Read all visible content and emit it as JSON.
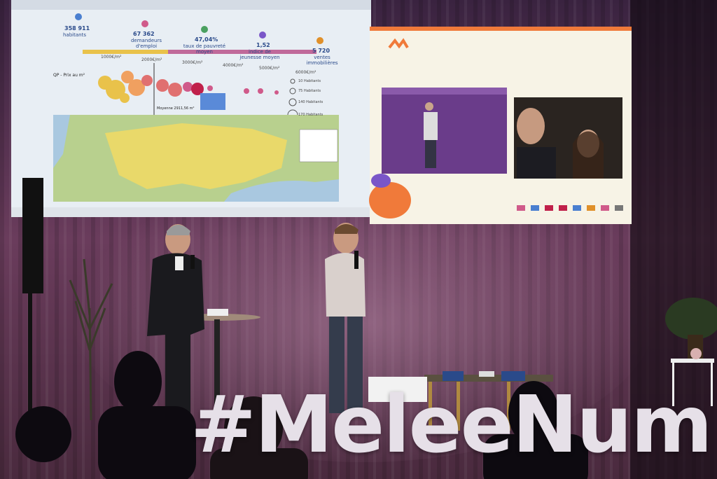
{
  "left_screen": {
    "stats": [
      {
        "value": "358 911",
        "label": "habitants"
      },
      {
        "value": "67 362",
        "label": "demandeurs d'emploi"
      },
      {
        "value": "47,04%",
        "label": "taux de pauvreté moyen"
      },
      {
        "value": "1,52",
        "label": "indice de jeunesse moyen"
      },
      {
        "value": "5 720",
        "label": "ventes immobilières"
      }
    ],
    "scale_labels": [
      "1000€/m²",
      "2000€/m²",
      "3000€/m²",
      "4000€/m²",
      "5000€/m²",
      "6000€/m²"
    ],
    "row_label": "QP - Prix au m²",
    "median_label": "Moyenne 2911,56 m²",
    "legend": [
      "10 Habitants",
      "75 Habitants",
      "140 Habitants",
      "170 Habitants"
    ]
  },
  "right_screen": {
    "logo_text": "MN",
    "bubble_colors": [
      "#f07a3a",
      "#7a56c8"
    ]
  },
  "stage_text": "#MeleeNum",
  "colors": {
    "curtain": "#5a3352",
    "screen_left": "#e8eef4",
    "screen_right": "#f7f3e6",
    "map_yellow": "#e9d96a",
    "map_green": "#b8d08e",
    "map_sea": "#a9c8e0"
  }
}
